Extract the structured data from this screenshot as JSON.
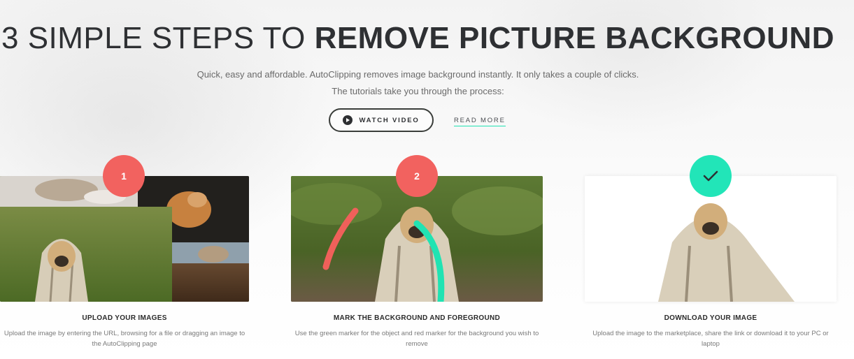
{
  "hero": {
    "title_light": "3 SIMPLE STEPS TO ",
    "title_bold": "REMOVE PICTURE BACKGROUND",
    "subtitle_line1": "Quick, easy and affordable. AutoClipping removes image background instantly. It only takes a couple of clicks.",
    "subtitle_line2": "The tutorials take you through the process:"
  },
  "actions": {
    "watch_video": "WATCH VIDEO",
    "read_more": "READ MORE"
  },
  "steps": [
    {
      "badge": "1",
      "title": "UPLOAD YOUR IMAGES",
      "description": "Upload the image by entering the URL, browsing for a file or dragging an image to the AutoClipping page"
    },
    {
      "badge": "2",
      "title": "MARK THE BACKGROUND AND FOREGROUND",
      "description": "Use the green marker for the object and red marker for the background you wish to remove"
    },
    {
      "badge_icon": "checkmark-icon",
      "title": "DOWNLOAD YOUR IMAGE",
      "description": "Upload the image to the marketplace, share the link or download it to your PC or laptop"
    }
  ],
  "colors": {
    "badge_red": "#f2625f",
    "badge_green": "#22e5b8",
    "marker_red": "#f0605a",
    "marker_green": "#20e3b2",
    "text_dark": "#2e3033"
  }
}
